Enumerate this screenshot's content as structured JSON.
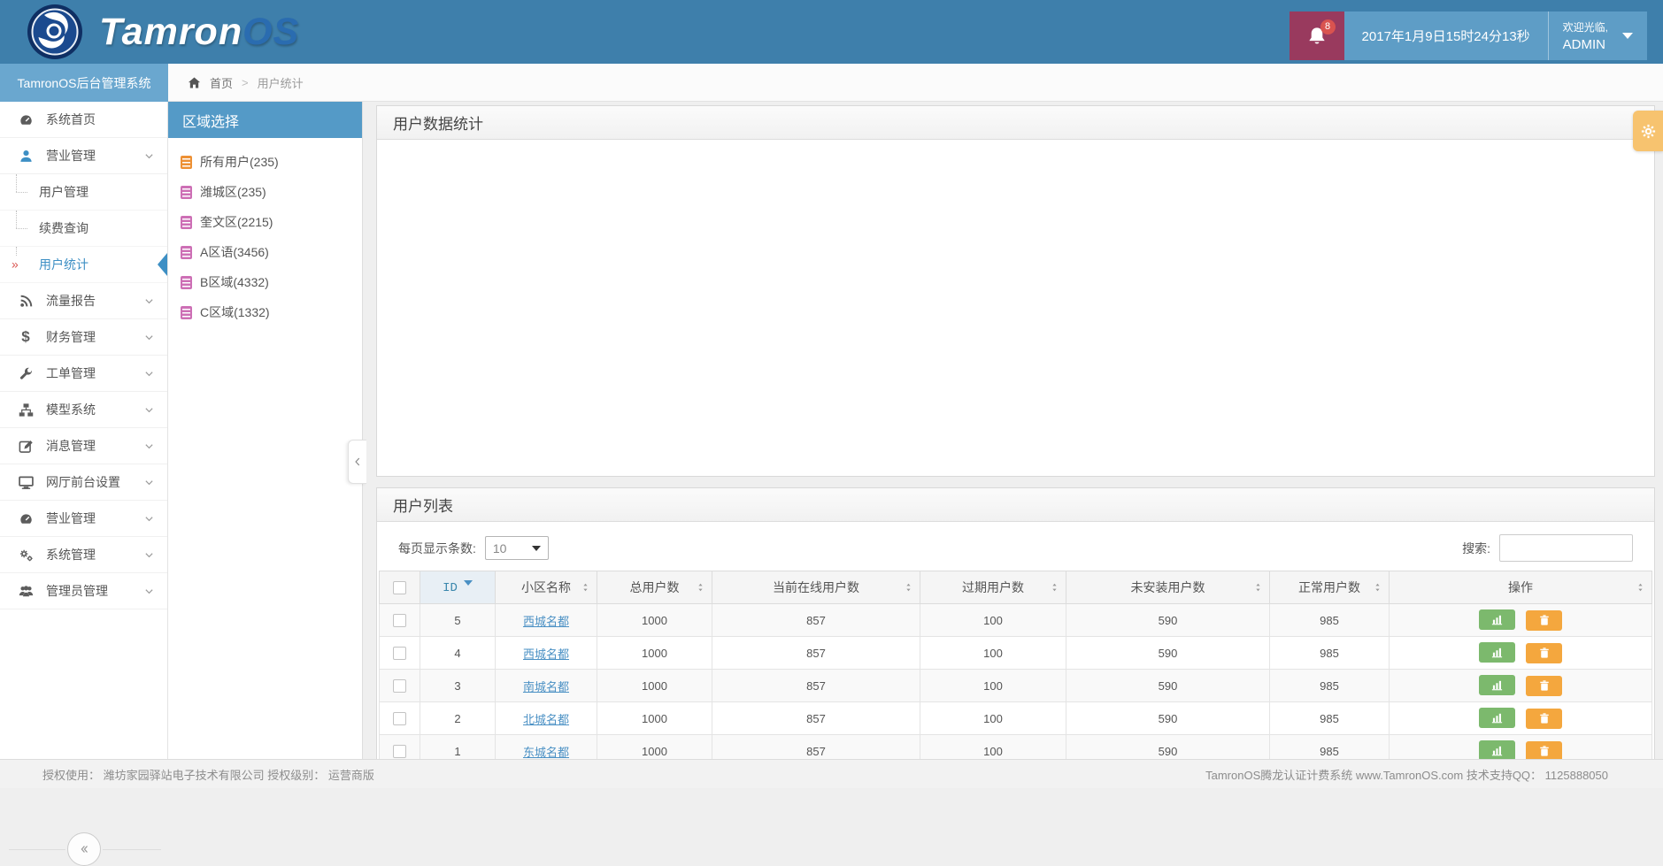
{
  "header": {
    "logo_primary": "Tamron",
    "logo_secondary": "OS",
    "notification_count": "8",
    "datetime": "2017年1月9日15时24分13秒",
    "welcome_line1": "欢迎光临,",
    "welcome_line2": "ADMIN"
  },
  "sidebar": {
    "title": "TamronOS后台管理系统",
    "items": [
      {
        "id": "system-home",
        "label": "系统首页",
        "icon": "dashboard-icon",
        "expandable": false
      },
      {
        "id": "business-mgmt",
        "label": "营业管理",
        "icon": "user-icon",
        "icon_accent": true,
        "expandable": true,
        "expanded": true,
        "children": [
          {
            "id": "user-mgmt",
            "label": "用户管理"
          },
          {
            "id": "renewal-query",
            "label": "续费查询"
          },
          {
            "id": "user-stats",
            "label": "用户统计",
            "active": true,
            "active_marker": "»"
          }
        ]
      },
      {
        "id": "traffic-report",
        "label": "流量报告",
        "icon": "rss-icon",
        "expandable": true
      },
      {
        "id": "finance-mgmt",
        "label": "财务管理",
        "icon": "dollar-icon",
        "expandable": true
      },
      {
        "id": "work-order-mgmt",
        "label": "工单管理",
        "icon": "wrench-icon",
        "expandable": true
      },
      {
        "id": "model-system",
        "label": "模型系统",
        "icon": "sitemap-icon",
        "expandable": true
      },
      {
        "id": "message-mgmt",
        "label": "消息管理",
        "icon": "edit-icon",
        "expandable": true
      },
      {
        "id": "portal-settings",
        "label": "网厅前台设置",
        "icon": "desktop-icon",
        "expandable": true
      },
      {
        "id": "business-mgmt-2",
        "label": "营业管理",
        "icon": "dashboard-icon",
        "expandable": true
      },
      {
        "id": "system-mgmt",
        "label": "系统管理",
        "icon": "gears-icon",
        "expandable": true
      },
      {
        "id": "admin-mgmt",
        "label": "管理员管理",
        "icon": "users-icon",
        "expandable": true
      }
    ]
  },
  "breadcrumb": {
    "home": "首页",
    "separator": ">",
    "current": "用户统计"
  },
  "region_panel": {
    "title": "区域选择",
    "items": [
      {
        "label": "所有用户(235)",
        "color": "#ed9135"
      },
      {
        "label": "潍城区(235)",
        "color": "#cd6fb5"
      },
      {
        "label": "奎文区(2215)",
        "color": "#cd6fb5"
      },
      {
        "label": "A区语(3456)",
        "color": "#cd6fb5"
      },
      {
        "label": "B区域(4332)",
        "color": "#cd6fb5"
      },
      {
        "label": "C区域(1332)",
        "color": "#cd6fb5"
      }
    ]
  },
  "stats_panel": {
    "title": "用户数据统计"
  },
  "list_panel": {
    "title": "用户列表",
    "page_size_label": "每页显示条数:",
    "page_size_value": "10",
    "search_label": "搜索:",
    "table": {
      "columns": [
        {
          "key": "checkbox",
          "label": ""
        },
        {
          "key": "id",
          "label": "ID",
          "sorted": true
        },
        {
          "key": "name",
          "label": "小区名称",
          "sortable": true
        },
        {
          "key": "total",
          "label": "总用户数",
          "sortable": true
        },
        {
          "key": "online",
          "label": "当前在线用户数",
          "sortable": true
        },
        {
          "key": "expired",
          "label": "过期用户数",
          "sortable": true
        },
        {
          "key": "uninstalled",
          "label": "未安装用户数",
          "sortable": true
        },
        {
          "key": "normal",
          "label": "正常用户数",
          "sortable": true
        },
        {
          "key": "ops",
          "label": "操作",
          "sortable": true
        }
      ],
      "rows": [
        {
          "id": "5",
          "name": "西城名都",
          "total": "1000",
          "online": "857",
          "expired": "100",
          "uninstalled": "590",
          "normal": "985"
        },
        {
          "id": "4",
          "name": "西城名都",
          "total": "1000",
          "online": "857",
          "expired": "100",
          "uninstalled": "590",
          "normal": "985"
        },
        {
          "id": "3",
          "name": "南城名都",
          "total": "1000",
          "online": "857",
          "expired": "100",
          "uninstalled": "590",
          "normal": "985"
        },
        {
          "id": "2",
          "name": "北城名都",
          "total": "1000",
          "online": "857",
          "expired": "100",
          "uninstalled": "590",
          "normal": "985"
        },
        {
          "id": "1",
          "name": "东城名都",
          "total": "1000",
          "online": "857",
          "expired": "100",
          "uninstalled": "590",
          "normal": "985"
        }
      ],
      "row_actions": [
        {
          "id": "view-stats",
          "icon": "chart-bars-icon",
          "style": "green"
        },
        {
          "id": "delete",
          "icon": "trash-icon",
          "style": "orange"
        }
      ]
    }
  },
  "footer": {
    "left": "授权使用： 潍坊家园驿站电子技术有限公司  授权级别： 运营商版",
    "right": "TamronOS腾龙认证计费系统 www.TamronOS.com 技术支持QQ： 1125888050"
  },
  "colors": {
    "header_bg": "#3e7fab",
    "secondary_bar_blue": "#6aa7cf",
    "region_header_blue": "#549ac7",
    "accent_blue": "#3d8fc4",
    "notification_block_maroon": "#993a5e",
    "badge_red": "#d9534f",
    "link_blue": "#4a90c4",
    "stats_button_green": "#7cb96d",
    "delete_button_orange": "#f4a73e",
    "settings_flyout_orange": "#f7c36f"
  }
}
